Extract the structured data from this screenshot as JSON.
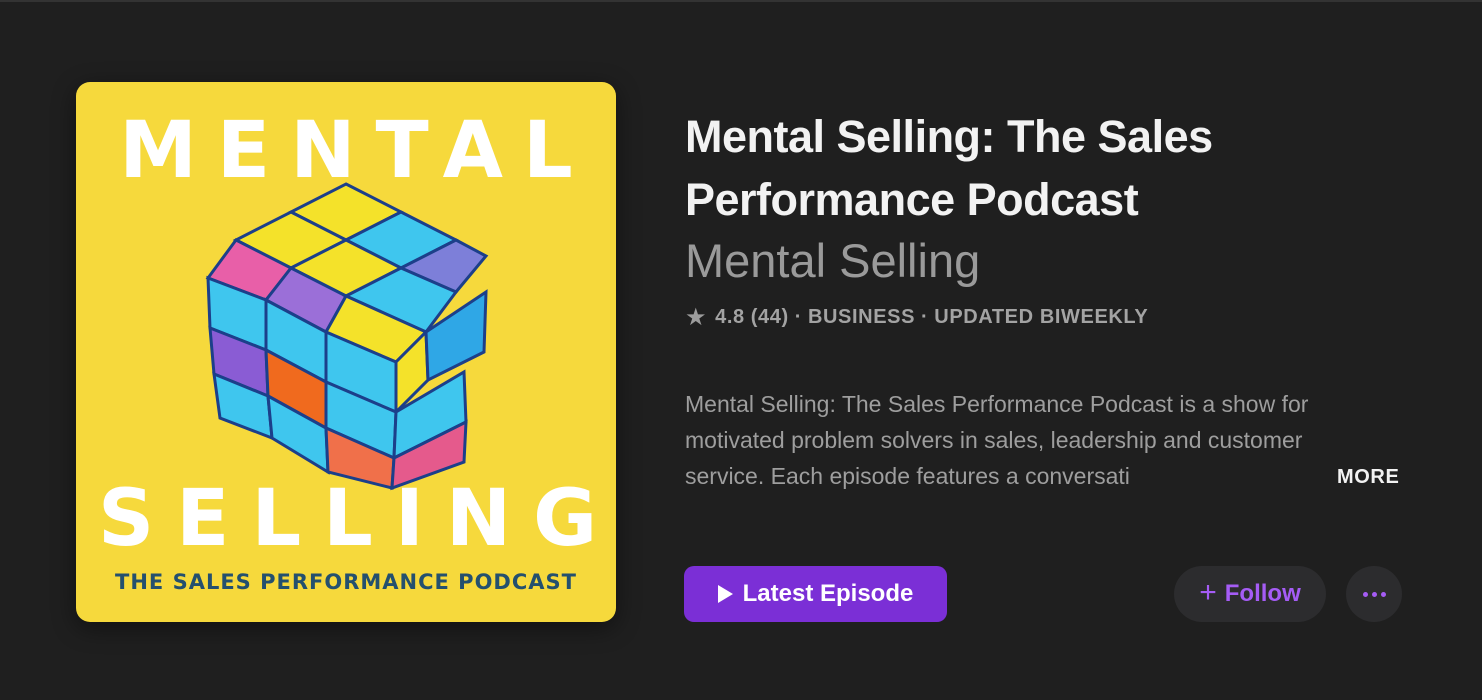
{
  "artwork": {
    "top_word": "MENTAL",
    "bottom_word": "SELLING",
    "subtitle": "THE SALES PERFORMANCE PODCAST",
    "background_color": "#f6d93c"
  },
  "podcast": {
    "title": "Mental Selling: The Sales Performance Podcast",
    "author": "Mental Selling",
    "rating": "4.8",
    "rating_count": "(44)",
    "separator": "·",
    "category": "BUSINESS",
    "update_frequency": "UPDATED BIWEEKLY",
    "description": "Mental Selling: The Sales Performance Podcast is a show for motivated problem solvers in sales, leadership and customer service. Each episode features a conversati",
    "more_label": "MORE"
  },
  "actions": {
    "latest_episode_label": "Latest Episode",
    "follow_label": "Follow",
    "accent_color": "#7b2fd6",
    "follow_color": "#a55cf5"
  },
  "icons": {
    "star": "star-icon",
    "play": "play-icon",
    "plus": "plus-icon",
    "more": "ellipsis-icon"
  }
}
